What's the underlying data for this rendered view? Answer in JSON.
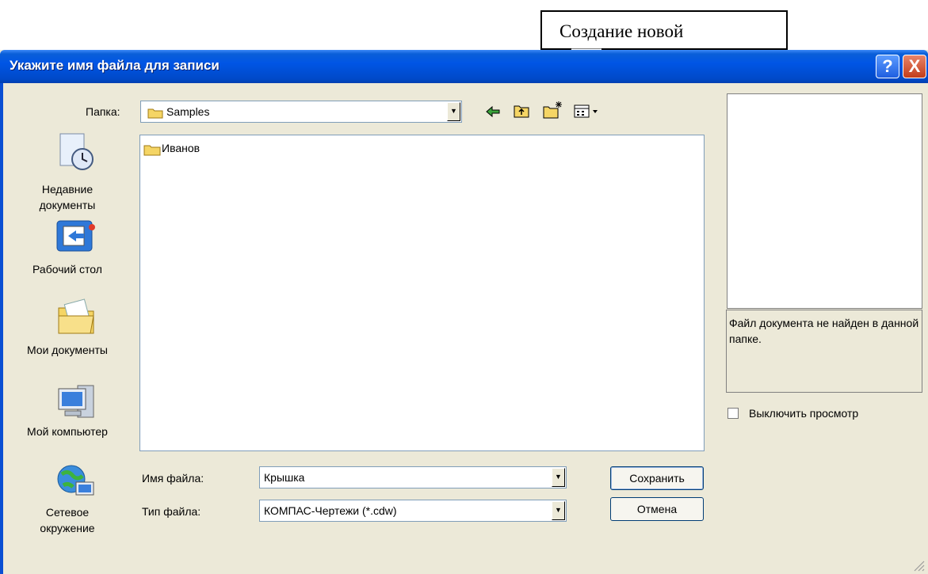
{
  "callout": {
    "text": "Создание новой"
  },
  "window": {
    "title": "Укажите имя файла для записи",
    "help_label": "?",
    "close_label": "X"
  },
  "folder": {
    "label": "Папка:",
    "value": "Samples"
  },
  "places": [
    {
      "label_line1": "Недавние",
      "label_line2": "документы",
      "icon": "recent-documents-icon"
    },
    {
      "label_line1": "Рабочий стол",
      "label_line2": "",
      "icon": "desktop-icon"
    },
    {
      "label_line1": "Мои документы",
      "label_line2": "",
      "icon": "my-documents-icon"
    },
    {
      "label_line1": "Мой компьютер",
      "label_line2": "",
      "icon": "my-computer-icon"
    },
    {
      "label_line1": "Сетевое",
      "label_line2": "окружение",
      "icon": "network-icon"
    }
  ],
  "files": [
    {
      "name": "Иванов",
      "icon": "folder-icon"
    }
  ],
  "filename": {
    "label": "Имя файла:",
    "value": "Крышка"
  },
  "filetype": {
    "label": "Тип файла:",
    "value": "КОМПАС-Чертежи (*.cdw)"
  },
  "buttons": {
    "save": "Сохранить",
    "cancel": "Отмена"
  },
  "preview": {
    "message": "Файл документа не найден в данной папке.",
    "disable_label": "Выключить просмотр",
    "disable_checked": false
  },
  "colors": {
    "titlebar": "#0055e5",
    "dialog_bg": "#ece9d8",
    "folder_yellow": "#f5d565"
  }
}
